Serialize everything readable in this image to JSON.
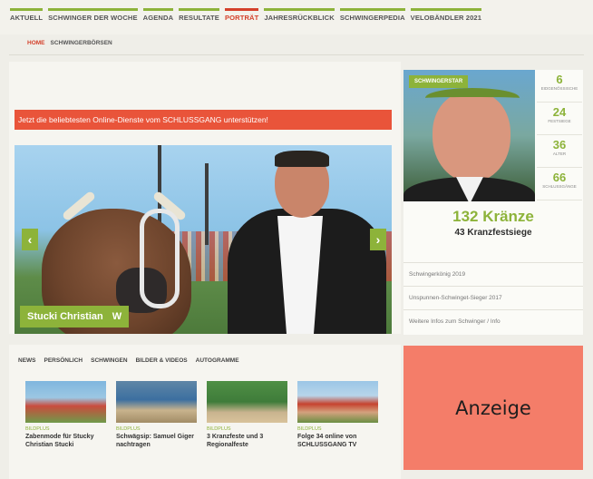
{
  "nav": {
    "items": [
      {
        "label": "Aktuell",
        "active": false
      },
      {
        "label": "Schwinger der Woche",
        "active": false
      },
      {
        "label": "Agenda",
        "active": false
      },
      {
        "label": "Resultate",
        "active": false
      },
      {
        "label": "Porträt",
        "active": true
      },
      {
        "label": "Jahresrückblick",
        "active": false
      },
      {
        "label": "Schwingerpedia",
        "active": false
      },
      {
        "label": "Velobändler 2021",
        "active": false
      }
    ]
  },
  "breadcrumb": {
    "home": "Home",
    "current": "Schwingerbörsen"
  },
  "banner": {
    "text": "Jetzt die beliebtesten Online-Dienste vom SCHLUSSGANG unterstützen!"
  },
  "hero": {
    "caption": "Stucki Christian",
    "logo": "W",
    "prev": "‹",
    "next": "›"
  },
  "profile": {
    "tag": "Schwingerstar",
    "stats": [
      {
        "value": "6",
        "label": "Eidgenössische"
      },
      {
        "value": "24",
        "label": "Festsiege"
      },
      {
        "value": "36",
        "label": "Alter"
      },
      {
        "value": "66",
        "label": "Schlussgänge"
      }
    ],
    "kranze": "132 Kränze",
    "festsiege": "43 Kranzfestsiege",
    "links": [
      "Schwingerkönig 2019",
      "Unspunnen-Schwinget-Sieger 2017",
      "Weitere Infos zum Schwinger / Info"
    ]
  },
  "news": {
    "tabs": [
      "News",
      "Persönlich",
      "Schwingen",
      "Bilder & Videos",
      "Autogramme"
    ],
    "cards": [
      {
        "category": "Bildplus",
        "title": "Zabenmode für Stucky Christian Stucki"
      },
      {
        "category": "Bildplus",
        "title": "Schwägsip: Samuel Giger nachtragen"
      },
      {
        "category": "Bildplus",
        "title": "3 Kranzfeste und 3 Regionalfeste"
      },
      {
        "category": "Bildplus",
        "title": "Folge 34 online von SCHLUSSGANG TV"
      }
    ]
  },
  "ad": {
    "label": "Anzeige"
  },
  "colors": {
    "accent": "#8db33a",
    "active_nav": "#d4412b",
    "banner": "#e9543a",
    "ad": "#f47d69"
  }
}
